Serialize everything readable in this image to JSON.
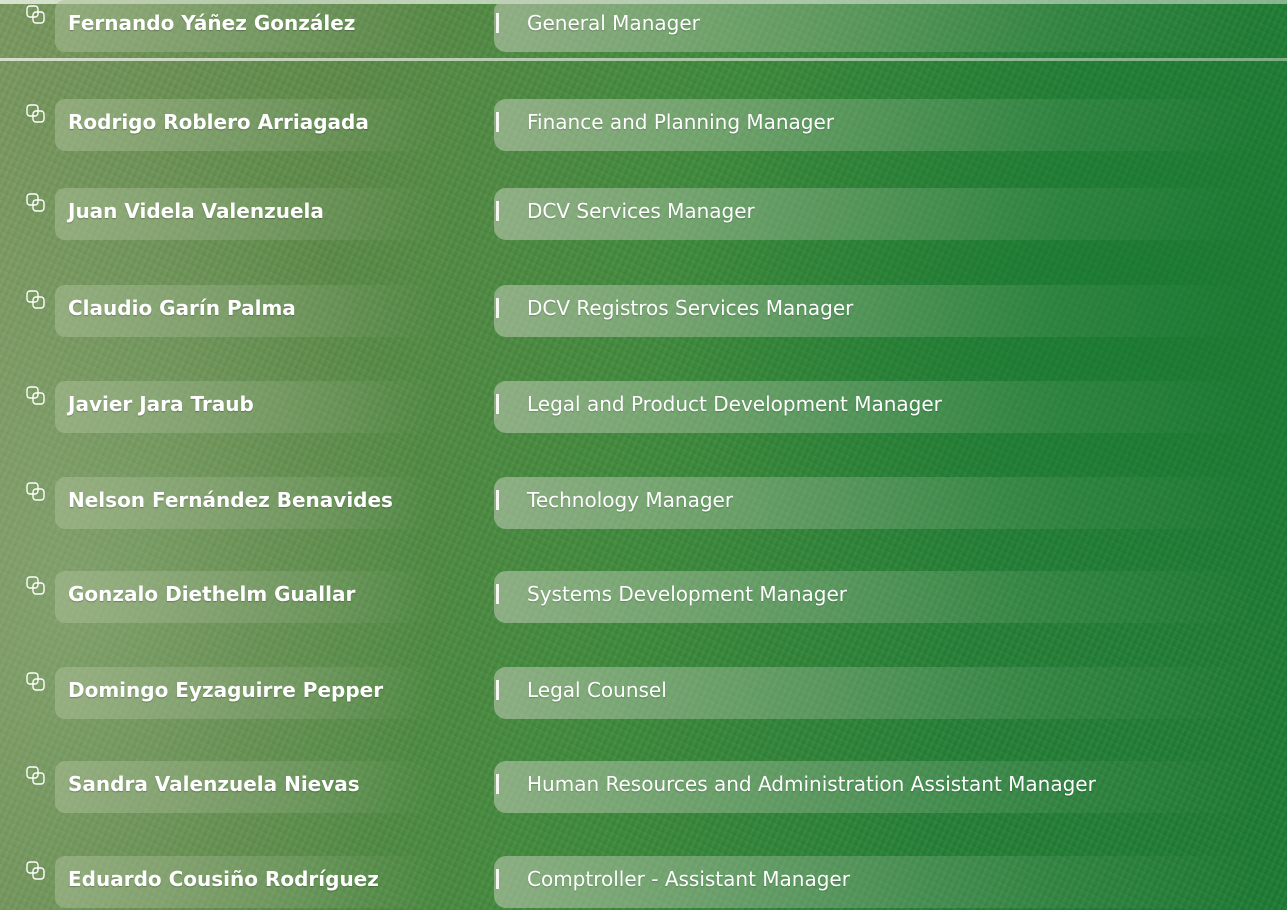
{
  "staff": [
    {
      "name": "Fernando Yáñez González",
      "title": "General Manager"
    },
    {
      "name": "Rodrigo Roblero Arriagada",
      "title": "Finance and Planning Manager"
    },
    {
      "name": "Juan Videla Valenzuela",
      "title": "DCV Services Manager"
    },
    {
      "name": "Claudio Garín Palma",
      "title": "DCV Registros Services Manager"
    },
    {
      "name": "Javier Jara Traub",
      "title": "Legal and Product Development Manager"
    },
    {
      "name": "Nelson Fernández  Benavides",
      "title": "Technology Manager"
    },
    {
      "name": "Gonzalo Diethelm Guallar",
      "title": "Systems Development Manager"
    },
    {
      "name": "Domingo Eyzaguirre Pepper",
      "title": "Legal Counsel"
    },
    {
      "name": "Sandra Valenzuela Nievas",
      "title": "Human Resources and Administration Assistant Manager"
    },
    {
      "name": "Eduardo Cousiño Rodríguez",
      "title": "Comptroller - Assistant Manager"
    }
  ],
  "colors": {
    "text": "#ffffff",
    "background_start": "#7a9860",
    "background_end": "#1d7a33"
  },
  "icons": {
    "bullet": "overlapping-squares-icon"
  }
}
